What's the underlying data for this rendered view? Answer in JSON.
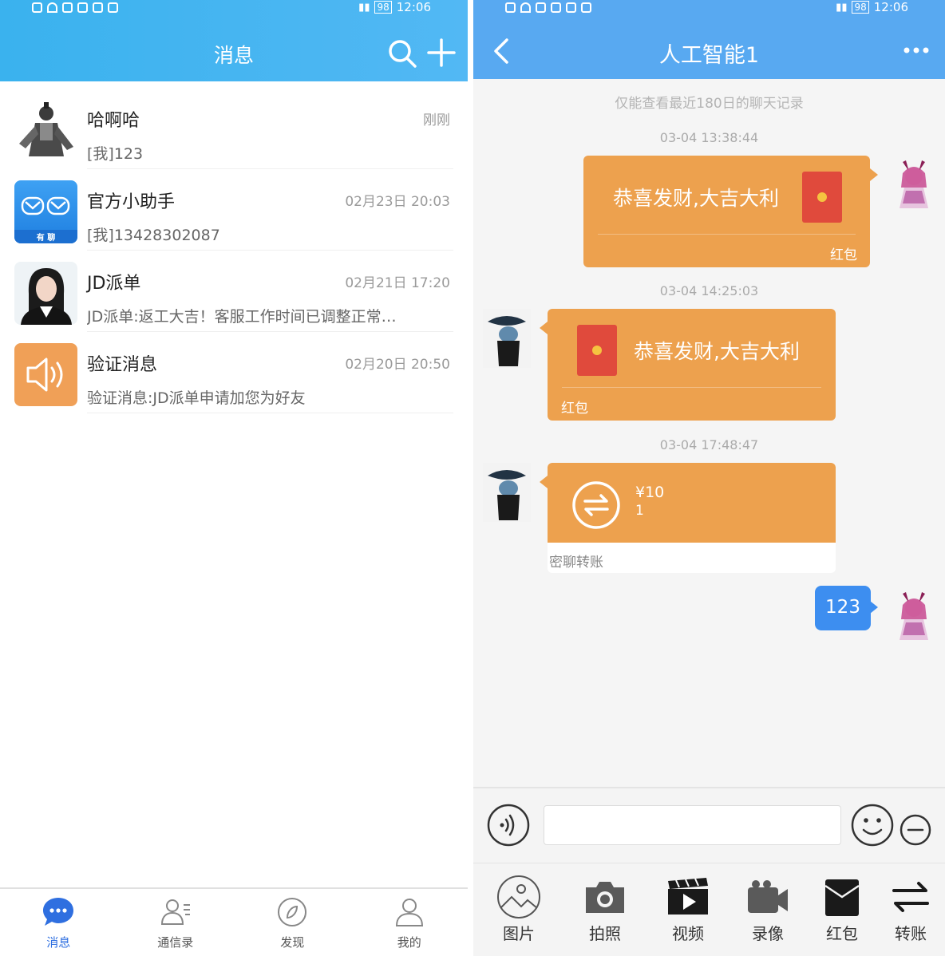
{
  "status_bar": {
    "time": "12:06",
    "battery": "98"
  },
  "messages_screen": {
    "title": "消息",
    "conversations": [
      {
        "name": "哈啊哈",
        "time": "刚刚",
        "preview": "[我]123"
      },
      {
        "name": "官方小助手",
        "time": "02月23日 20:03",
        "preview": "[我]13428302087"
      },
      {
        "name": "JD派单",
        "time": "02月21日 17:20",
        "preview": "JD派单:返工大吉！客服工作时间已调整正常…"
      },
      {
        "name": "验证消息",
        "time": "02月20日 20:50",
        "preview": "验证消息:JD派单申请加您为好友"
      }
    ],
    "assistant_avatar_text": "有 聊",
    "tabs": [
      {
        "label": "消息"
      },
      {
        "label": "通信录"
      },
      {
        "label": "发现"
      },
      {
        "label": "我的"
      }
    ]
  },
  "chat_screen": {
    "title": "人工智能1",
    "notice": "仅能查看最近180日的聊天记录",
    "timestamps": [
      "03-04 13:38:44",
      "03-04 14:25:03",
      "03-04 17:48:47"
    ],
    "red_packet_out": {
      "text": "恭喜发财,大吉大利",
      "label": "红包"
    },
    "red_packet_in": {
      "text": "恭喜发财,大吉大利",
      "label": "红包"
    },
    "transfer": {
      "amount": "¥10",
      "note": "1",
      "label": "密聊转账"
    },
    "text_message": "123",
    "toolbar": [
      {
        "label": "图片",
        "icon": "image-icon"
      },
      {
        "label": "拍照",
        "icon": "camera-icon"
      },
      {
        "label": "视频",
        "icon": "video-icon"
      },
      {
        "label": "录像",
        "icon": "record-icon"
      },
      {
        "label": "红包",
        "icon": "red-packet-icon"
      },
      {
        "label": "转账",
        "icon": "transfer-icon"
      }
    ]
  },
  "colors": {
    "header_blue": "#52b8f4",
    "bubble_orange": "#eda14e",
    "text_bubble_blue": "#3d8ef0",
    "tab_active": "#2f6fe0"
  }
}
